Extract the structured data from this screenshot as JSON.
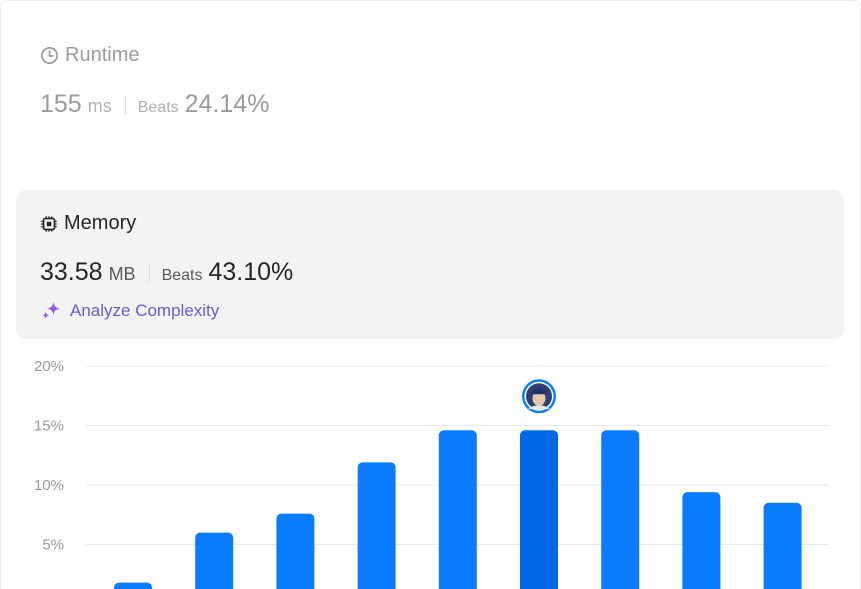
{
  "runtime": {
    "title": "Runtime",
    "icon": "clock-icon",
    "value": "155",
    "unit": "ms",
    "beats_label": "Beats",
    "beats_pct": "24.14%"
  },
  "memory": {
    "title": "Memory",
    "icon": "chip-icon",
    "value": "33.58",
    "unit": "MB",
    "beats_label": "Beats",
    "beats_pct": "43.10%"
  },
  "analyze": {
    "label": "Analyze Complexity",
    "icon": "sparkle-icon"
  },
  "colors": {
    "bar": "#0a7cff",
    "bar_highlight": "#0067e6",
    "analyze": "#6b58d6"
  },
  "chart_data": {
    "type": "bar",
    "y_tick_labels": [
      "20%",
      "15%",
      "10%",
      "5%"
    ],
    "y_ticks": [
      20,
      15,
      10,
      5
    ],
    "values": [
      1.8,
      6.0,
      7.6,
      11.9,
      14.6,
      14.6,
      14.6,
      9.4,
      8.5
    ],
    "highlight_index": 5,
    "grid": true
  }
}
